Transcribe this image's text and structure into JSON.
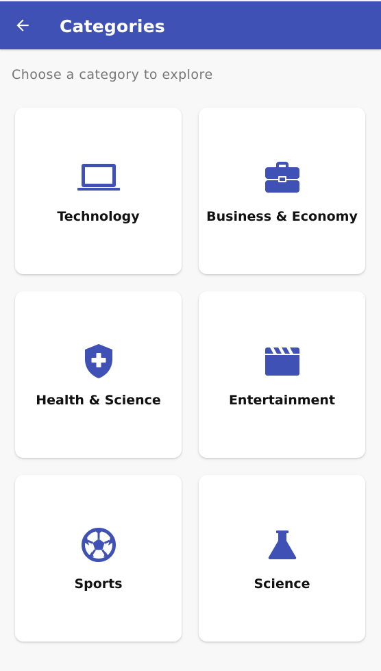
{
  "appbar": {
    "title": "Categories",
    "back_icon": "arrow-back-icon",
    "color": "#3f51b5"
  },
  "subtitle": "Choose a category to explore",
  "accent_color": "#3f51b5",
  "categories": [
    {
      "label": "Technology",
      "icon": "laptop-icon"
    },
    {
      "label": "Business & Economy",
      "icon": "briefcase-icon"
    },
    {
      "label": "Health & Science",
      "icon": "health-shield-icon"
    },
    {
      "label": "Entertainment",
      "icon": "clapperboard-icon"
    },
    {
      "label": "Sports",
      "icon": "soccer-ball-icon"
    },
    {
      "label": "Science",
      "icon": "flask-icon"
    }
  ]
}
